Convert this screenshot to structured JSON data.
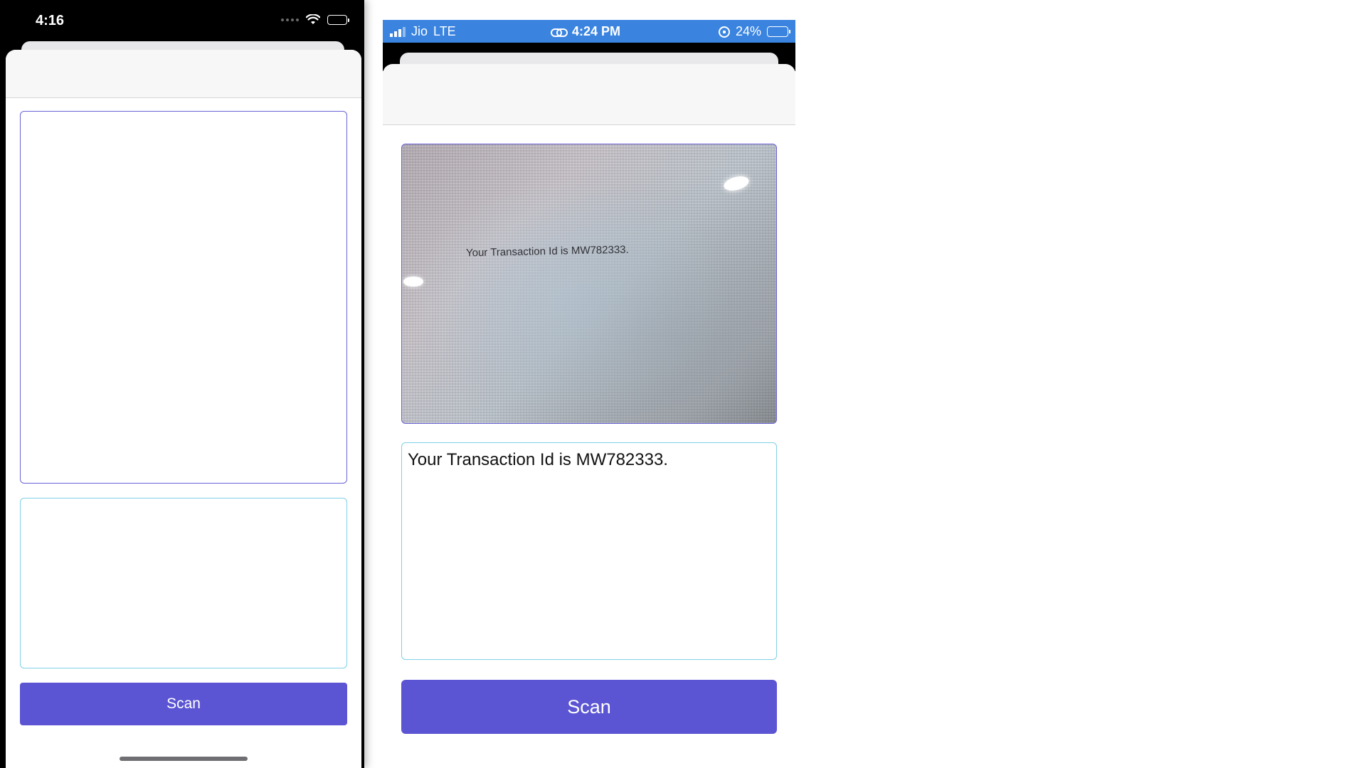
{
  "left_phone": {
    "status_bar": {
      "time": "4:16"
    },
    "scan_button": {
      "label": "Scan"
    }
  },
  "right_phone": {
    "status_bar": {
      "carrier": "Jio",
      "network": "LTE",
      "time": "4:24 PM",
      "battery_percent": "24%",
      "color": "#3a84e0"
    },
    "photo": {
      "visible_text": "Your Transaction Id is MW782333."
    },
    "result_text": "Your Transaction Id is MW782333.",
    "scan_button": {
      "label": "Scan"
    }
  },
  "colors": {
    "accent": "#5b55d3",
    "image_box_border": "#6a62d6",
    "text_box_border": "#7fd0e6"
  },
  "icons": [
    "wifi-icon",
    "battery-icon",
    "signal-icon",
    "link-icon",
    "rotation-lock-icon"
  ]
}
